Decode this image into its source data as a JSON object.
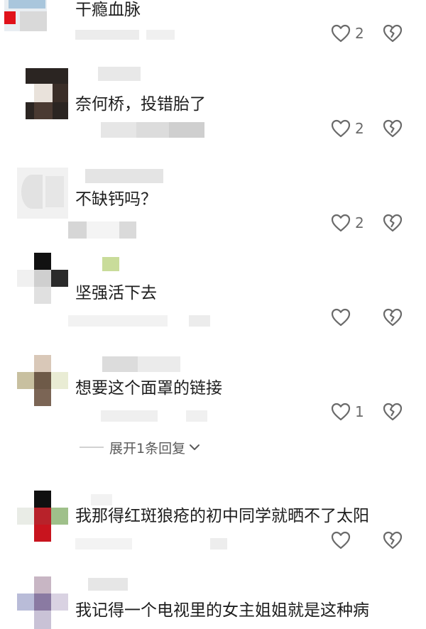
{
  "comments": [
    {
      "text": "干瘾血脉",
      "likes": "2"
    },
    {
      "text": "奈何桥，投错胎了",
      "likes": "2"
    },
    {
      "text": "不缺钙吗？",
      "likes": "2"
    },
    {
      "text": "坚强活下去",
      "likes": ""
    },
    {
      "text": "想要这个面罩的链接",
      "likes": "1"
    },
    {
      "text": "我那得红斑狼疮的初中同学就晒不了太阳",
      "likes": ""
    },
    {
      "text": "我记得一个电视里的女主姐姐就是这种病",
      "likes": ""
    }
  ],
  "reply_toggle": {
    "label": "展开1条回复"
  },
  "colors": {
    "icon": "#6a6a6a",
    "text": "#1e1e1e",
    "muted": "#6b6b6b"
  }
}
